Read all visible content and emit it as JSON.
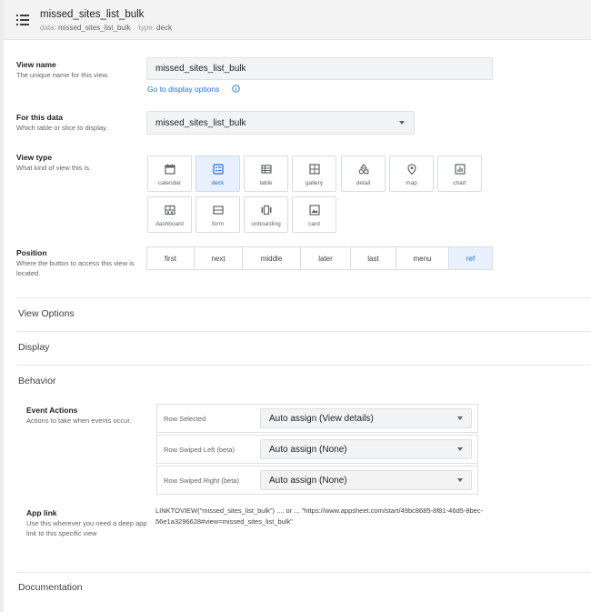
{
  "header": {
    "title": "missed_sites_list_bulk",
    "data_label": "data:",
    "data_value": "missed_sites_list_bulk",
    "type_label": "type:",
    "type_value": "deck"
  },
  "view_name": {
    "label": "View name",
    "help": "The unique name for this view.",
    "value": "missed_sites_list_bulk",
    "link": "Go to display options"
  },
  "for_this_data": {
    "label": "For this data",
    "help": "Which table or slice to display.",
    "value": "missed_sites_list_bulk"
  },
  "view_type": {
    "label": "View type",
    "help": "What kind of view this is.",
    "selected": "deck",
    "options": [
      {
        "label": "calendar",
        "icon": "calendar-icon"
      },
      {
        "label": "deck",
        "icon": "deck-icon"
      },
      {
        "label": "table",
        "icon": "table-icon"
      },
      {
        "label": "gallery",
        "icon": "gallery-icon"
      },
      {
        "label": "detail",
        "icon": "detail-icon"
      },
      {
        "label": "map",
        "icon": "map-pin-icon"
      },
      {
        "label": "chart",
        "icon": "chart-icon"
      },
      {
        "label": "dashboard",
        "icon": "dashboard-icon"
      },
      {
        "label": "form",
        "icon": "form-icon"
      },
      {
        "label": "onboarding",
        "icon": "onboarding-icon"
      },
      {
        "label": "card",
        "icon": "card-icon"
      }
    ]
  },
  "position": {
    "label": "Position",
    "help": "Where the button to access this view is located.",
    "selected": "ref",
    "options": [
      "first",
      "next",
      "middle",
      "later",
      "last",
      "menu",
      "ref"
    ]
  },
  "sections": {
    "view_options": "View Options",
    "display": "Display",
    "behavior": "Behavior",
    "documentation": "Documentation"
  },
  "event_actions": {
    "label": "Event Actions",
    "help": "Actions to take when events occur.",
    "rows": [
      {
        "name": "Row Selected",
        "value": "Auto assign (View details)"
      },
      {
        "name": "Row Swiped Left (beta)",
        "value": "Auto assign (None)"
      },
      {
        "name": "Row Swiped Right (beta)",
        "value": "Auto assign (None)"
      }
    ]
  },
  "app_link": {
    "label": "App link",
    "help": "Use this wherever you need a deep app link to this specific view",
    "value": "LINKTOVIEW(\"missed_sites_list_bulk\") .... or ... \"https://www.appsheet.com/start/49bc8685-8f81-46d5-8bec-56e1a3296628#view=missed_sites_list_bulk\""
  },
  "colors": {
    "accent": "#1a73e8",
    "selected_bg": "#e8f0fe",
    "input_bg": "#f1f3f4"
  }
}
